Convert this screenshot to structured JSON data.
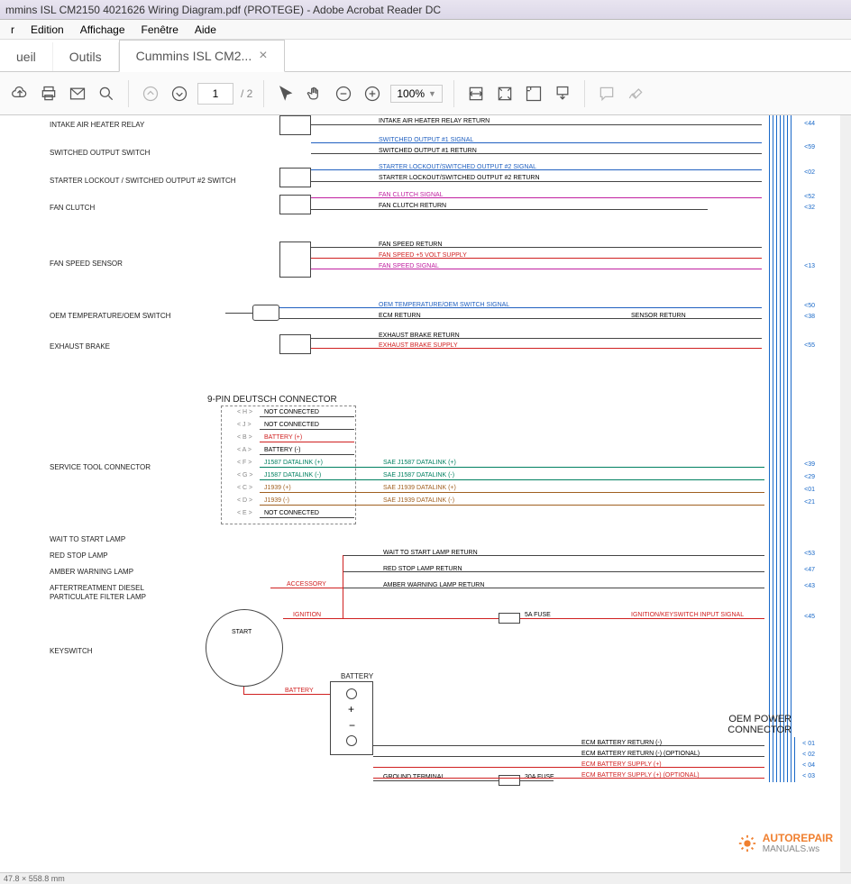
{
  "window": {
    "title": "mmins ISL CM2150 4021626 Wiring Diagram.pdf (PROTEGE) - Adobe Acrobat Reader DC"
  },
  "menu": {
    "items": [
      "r",
      "Edition",
      "Affichage",
      "Fenêtre",
      "Aide"
    ]
  },
  "tabs": {
    "home": "ueil",
    "tools": "Outils",
    "doc": "Cummins ISL CM2..."
  },
  "toolbar": {
    "page": "1",
    "total_pages": "/ 2",
    "zoom": "100%"
  },
  "labels": {
    "l1": "INTAKE AIR HEATER RELAY",
    "l2": "SWITCHED OUTPUT SWITCH",
    "l3": "STARTER LOCKOUT / SWITCHED OUTPUT #2 SWITCH",
    "l4": "FAN CLUTCH",
    "l5": "FAN SPEED SENSOR",
    "l6": "OEM TEMPERATURE/OEM SWITCH",
    "l7": "EXHAUST BRAKE",
    "l8": "SERVICE TOOL CONNECTOR",
    "l9": "WAIT TO START LAMP",
    "l10": "RED STOP LAMP",
    "l11": "AMBER WARNING LAMP",
    "l12": "AFTERTREATMENT DIESEL",
    "l12b": "PARTICULATE FILTER LAMP",
    "l13": "KEYSWITCH",
    "deutsch": "9-PIN DEUTSCH CONNECTOR",
    "battery": "BATTERY",
    "ground": "GROUND TERMINAL",
    "oem_conn1": "OEM POWER",
    "oem_conn2": "CONNECTOR",
    "start": "START"
  },
  "signals": {
    "s1": "INTAKE AIR HEATER RELAY RETURN",
    "s2a": "SWITCHED OUTPUT #1 SIGNAL",
    "s2b": "SWITCHED OUTPUT #1 RETURN",
    "s3a": "STARTER LOCKOUT/SWITCHED OUTPUT #2 SIGNAL",
    "s3b": "STARTER LOCKOUT/SWITCHED OUTPUT #2 RETURN",
    "s4a": "FAN CLUTCH SIGNAL",
    "s4b": "FAN CLUTCH RETURN",
    "s5a": "FAN SPEED RETURN",
    "s5b": "FAN SPEED +5 VOLT SUPPLY",
    "s5c": "FAN SPEED SIGNAL",
    "s6a": "OEM TEMPERATURE/OEM SWITCH SIGNAL",
    "s6b": "ECM RETURN",
    "s6c": "SENSOR RETURN",
    "s7a": "EXHAUST BRAKE RETURN",
    "s7b": "EXHAUST BRAKE SUPPLY",
    "d1": "NOT CONNECTED",
    "d2": "NOT CONNECTED",
    "d3": "BATTERY (+)",
    "d4": "BATTERY (-)",
    "d5": "J1587 DATALINK (+)",
    "d6": "J1587 DATALINK (-)",
    "d5r": "SAE J1587 DATALINK (+)",
    "d6r": "SAE J1587 DATALINK (-)",
    "d7": "J1939 (+)",
    "d8": "J1939 (-)",
    "d7r": "SAE J1939 DATALINK (+)",
    "d8r": "SAE J1939 DATALINK (-)",
    "d9": "NOT CONNECTED",
    "lamp1": "WAIT TO START LAMP RETURN",
    "lamp2": "RED STOP LAMP RETURN",
    "lamp3": "AMBER WARNING LAMP RETURN",
    "acc": "ACCESSORY",
    "ign": "IGNITION",
    "ign_sig": "IGNITION/KEYSWITCH INPUT SIGNAL",
    "fuse5": "5A FUSE",
    "fuse30": "30A FUSE",
    "batt": "BATTERY",
    "ecm1": "ECM BATTERY RETURN (-)",
    "ecm2": "ECM BATTERY RETURN (-) (OPTIONAL)",
    "ecm3": "ECM BATTERY SUPPLY (+)",
    "ecm4": "ECM BATTERY SUPPLY (+) (OPTIONAL)"
  },
  "pins": {
    "p44": "<44",
    "p59": "<59",
    "p02": "<02",
    "p52": "<52",
    "p32": "<32",
    "p13": "<13",
    "p50": "<50",
    "p38": "<38",
    "p55": "<55",
    "p39": "<39",
    "p29": "<29",
    "p01b": "<01",
    "p21": "<21",
    "p53": "<53",
    "p47": "<47",
    "p43": "<43",
    "p45": "<45",
    "p01": "< 01",
    "p02b": "< 02",
    "p04": "< 04",
    "p03": "< 03",
    "dH": "< H >",
    "dJ": "< J >",
    "dB": "< B >",
    "dA": "< A >",
    "dF": "< F >",
    "dG": "< G >",
    "dC": "< C >",
    "dD": "< D >",
    "dE": "< E >"
  },
  "watermark": {
    "text1": "AUTOREPAIR",
    "text2": "MANUALS.ws"
  },
  "status": {
    "coords": "47.8 × 558.8 mm"
  }
}
